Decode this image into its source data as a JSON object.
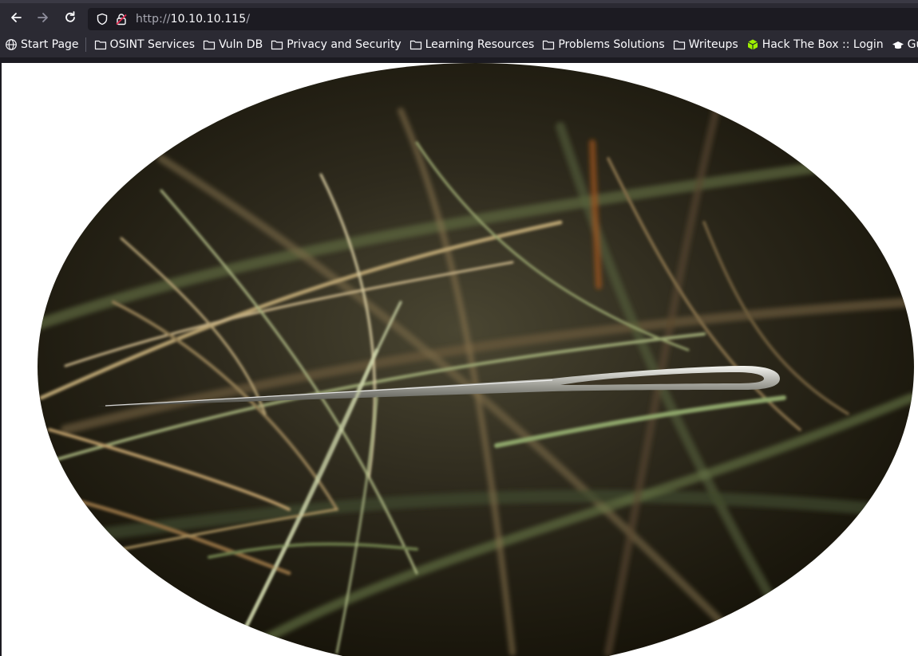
{
  "browser": {
    "url_protocol": "http://",
    "url_host": "10.10.10.115",
    "url_path": "/"
  },
  "bookmarks": [
    {
      "label": "Start Page",
      "icon": "globe-icon"
    },
    {
      "label": "OSINT Services",
      "icon": "folder-icon"
    },
    {
      "label": "Vuln DB",
      "icon": "folder-icon"
    },
    {
      "label": "Privacy and Security",
      "icon": "folder-icon"
    },
    {
      "label": "Learning Resources",
      "icon": "folder-icon"
    },
    {
      "label": "Problems Solutions",
      "icon": "folder-icon"
    },
    {
      "label": "Writeups",
      "icon": "folder-icon"
    },
    {
      "label": "Hack The Box :: Login",
      "icon": "htb-cube-icon"
    },
    {
      "label": "Guía C",
      "icon": "graduation-cap-icon"
    }
  ],
  "page": {
    "image_subject": "needle-in-haystack-image"
  },
  "colors": {
    "toolbar_bg": "#2b2a33",
    "url_bg": "#1c1b22",
    "text": "#fbfbfe",
    "htb_green": "#9fef00",
    "page_bg": "#ffffff"
  }
}
